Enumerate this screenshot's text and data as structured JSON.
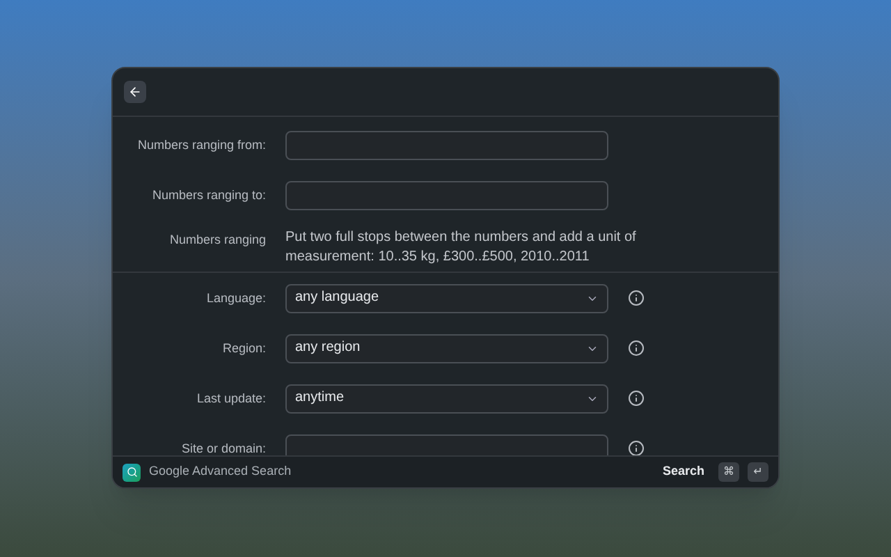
{
  "fields_top": [
    {
      "kind": "text",
      "label": "Numbers ranging from:"
    },
    {
      "kind": "text",
      "label": "Numbers ranging to:"
    },
    {
      "kind": "note",
      "label": "Numbers ranging",
      "note": "Put two full stops between the numbers and add a unit of measurement: 10..35 kg, £300..£500, 2010..2011"
    }
  ],
  "fields_bottom": [
    {
      "kind": "select",
      "label": "Language:",
      "value": "any language"
    },
    {
      "kind": "select",
      "label": "Region:",
      "value": "any region"
    },
    {
      "kind": "select",
      "label": "Last update:",
      "value": "anytime"
    },
    {
      "kind": "text",
      "label": "Site or domain:"
    }
  ],
  "footer": {
    "title": "Google Advanced Search",
    "action": "Search",
    "keys": [
      "⌘",
      "↵"
    ]
  }
}
